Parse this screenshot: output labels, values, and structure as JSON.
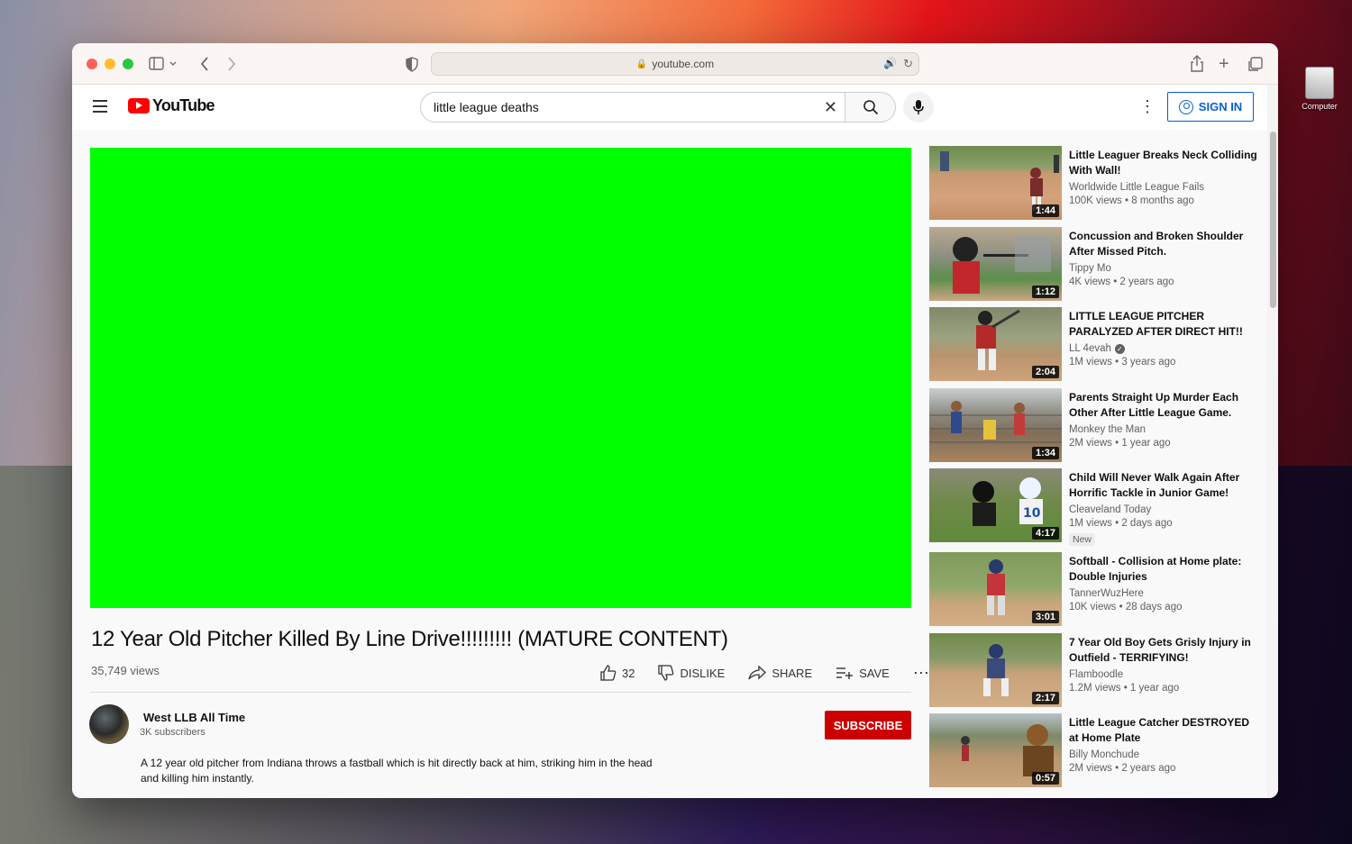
{
  "desktop": {
    "icon_label": "Computer"
  },
  "browser": {
    "url": "youtube.com"
  },
  "youtube": {
    "search_query": "little league deaths",
    "sign_in_label": "SIGN IN",
    "logo_text": "YouTube"
  },
  "video": {
    "title": "12 Year Old Pitcher Killed By Line Drive!!!!!!!!! (MATURE CONTENT)",
    "views": "35,749 views",
    "likes": "32",
    "dislike_label": "DISLIKE",
    "share_label": "SHARE",
    "save_label": "SAVE",
    "player_color": "#00ff00"
  },
  "channel": {
    "name": "West LLB All Time",
    "subscribers": "3K subscribers",
    "subscribe_label": "SUBSCRIBE",
    "description": "A 12 year old pitcher from Indiana throws a fastball which is hit directly back at him, striking him in the head and killing him instantly."
  },
  "related": [
    {
      "title": "Little Leaguer Breaks Neck Colliding With Wall!",
      "channel": "Worldwide Little League Fails",
      "meta": "100K views • 8 months ago",
      "duration": "1:44",
      "verified": false,
      "badge": ""
    },
    {
      "title": "Concussion and Broken Shoulder After Missed Pitch.",
      "channel": "Tippy Mo",
      "meta": "4K views • 2 years ago",
      "duration": "1:12",
      "verified": false,
      "badge": ""
    },
    {
      "title": "LITTLE LEAGUE PITCHER PARALYZED AFTER DIRECT HIT!!",
      "channel": "LL 4evah",
      "meta": "1M views • 3 years ago",
      "duration": "2:04",
      "verified": true,
      "badge": ""
    },
    {
      "title": "Parents Straight Up Murder Each Other After Little League Game.",
      "channel": "Monkey the Man",
      "meta": "2M views • 1 year ago",
      "duration": "1:34",
      "verified": false,
      "badge": ""
    },
    {
      "title": "Child Will Never Walk Again After Horrific Tackle in Junior Game!",
      "channel": "Cleaveland Today",
      "meta": "1M views • 2 days ago",
      "duration": "4:17",
      "verified": false,
      "badge": "New"
    },
    {
      "title": "Softball - Collision at Home plate: Double Injuries",
      "channel": "TannerWuzHere",
      "meta": "10K views • 28 days ago",
      "duration": "3:01",
      "verified": false,
      "badge": ""
    },
    {
      "title": "7 Year Old Boy Gets Grisly Injury in Outfield - TERRIFYING!",
      "channel": "Flamboodle",
      "meta": "1.2M views • 1 year ago",
      "duration": "2:17",
      "verified": false,
      "badge": ""
    },
    {
      "title": "Little League Catcher DESTROYED at Home Plate",
      "channel": "Billy Monchude",
      "meta": "2M views • 2 years ago",
      "duration": "0:57",
      "verified": false,
      "badge": ""
    }
  ]
}
